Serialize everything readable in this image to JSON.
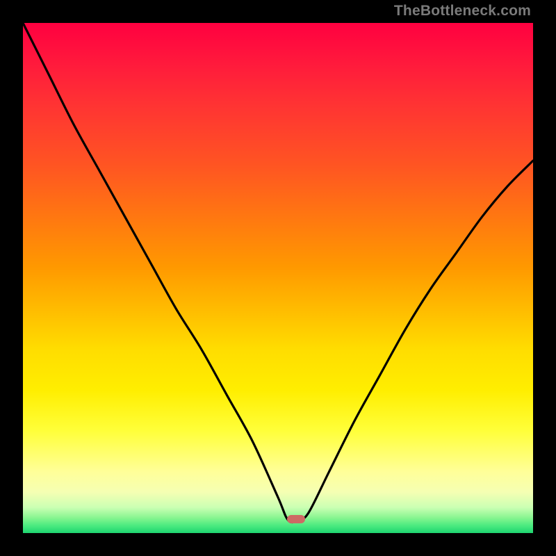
{
  "watermark": "TheBottleneck.com",
  "marker": {
    "x_frac": 0.536,
    "y_frac": 0.973
  },
  "chart_data": {
    "type": "line",
    "title": "",
    "xlabel": "",
    "ylabel": "",
    "xlim": [
      0,
      1
    ],
    "ylim": [
      0,
      1
    ],
    "series": [
      {
        "name": "bottleneck-curve",
        "x": [
          0.0,
          0.05,
          0.1,
          0.15,
          0.2,
          0.25,
          0.3,
          0.35,
          0.4,
          0.45,
          0.5,
          0.52,
          0.54,
          0.56,
          0.6,
          0.65,
          0.7,
          0.75,
          0.8,
          0.85,
          0.9,
          0.95,
          1.0
        ],
        "y": [
          1.0,
          0.9,
          0.8,
          0.71,
          0.62,
          0.53,
          0.44,
          0.36,
          0.27,
          0.18,
          0.07,
          0.025,
          0.025,
          0.04,
          0.12,
          0.22,
          0.31,
          0.4,
          0.48,
          0.55,
          0.62,
          0.68,
          0.73
        ]
      }
    ],
    "background_gradient": {
      "top": "#ff0040",
      "mid": "#ffee00",
      "bottom": "#1ed470"
    },
    "marker_point": {
      "x": 0.536,
      "y": 0.027
    }
  }
}
